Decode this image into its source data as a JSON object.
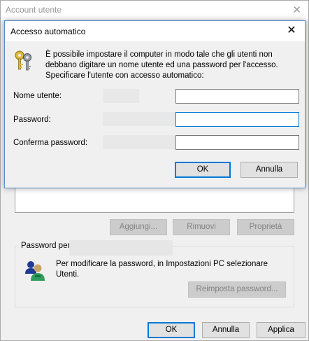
{
  "parent": {
    "title": "Account utente",
    "close_glyph": "✕",
    "buttons": {
      "add": "Aggiungi...",
      "remove": "Rimuovi",
      "properties": "Proprietà"
    },
    "password_group": {
      "legend": "Password per",
      "text": "Per modificare la password, in Impostazioni PC selezionare Utenti.",
      "reset_button": "Reimposta password..."
    },
    "footer": {
      "ok": "OK",
      "cancel": "Annulla",
      "apply": "Applica"
    }
  },
  "dialog": {
    "title": "Accesso automatico",
    "close_glyph": "✕",
    "info": "È possibile impostare il computer in modo tale che gli utenti non debbano digitare un nome utente ed una password per l'accesso. Specificare l'utente con accesso automatico:",
    "fields": {
      "username_label": "Nome utente:",
      "username_value": "",
      "password_label": "Password:",
      "password_value": "",
      "confirm_label": "Conferma password:",
      "confirm_value": ""
    },
    "ok": "OK",
    "cancel": "Annulla"
  },
  "colors": {
    "accent": "#0078d7",
    "window_bg": "#f0f0f0",
    "disabled_text": "#838383"
  },
  "icons": {
    "dialog_icon": "keys-icon",
    "group_icon": "users-icon"
  }
}
